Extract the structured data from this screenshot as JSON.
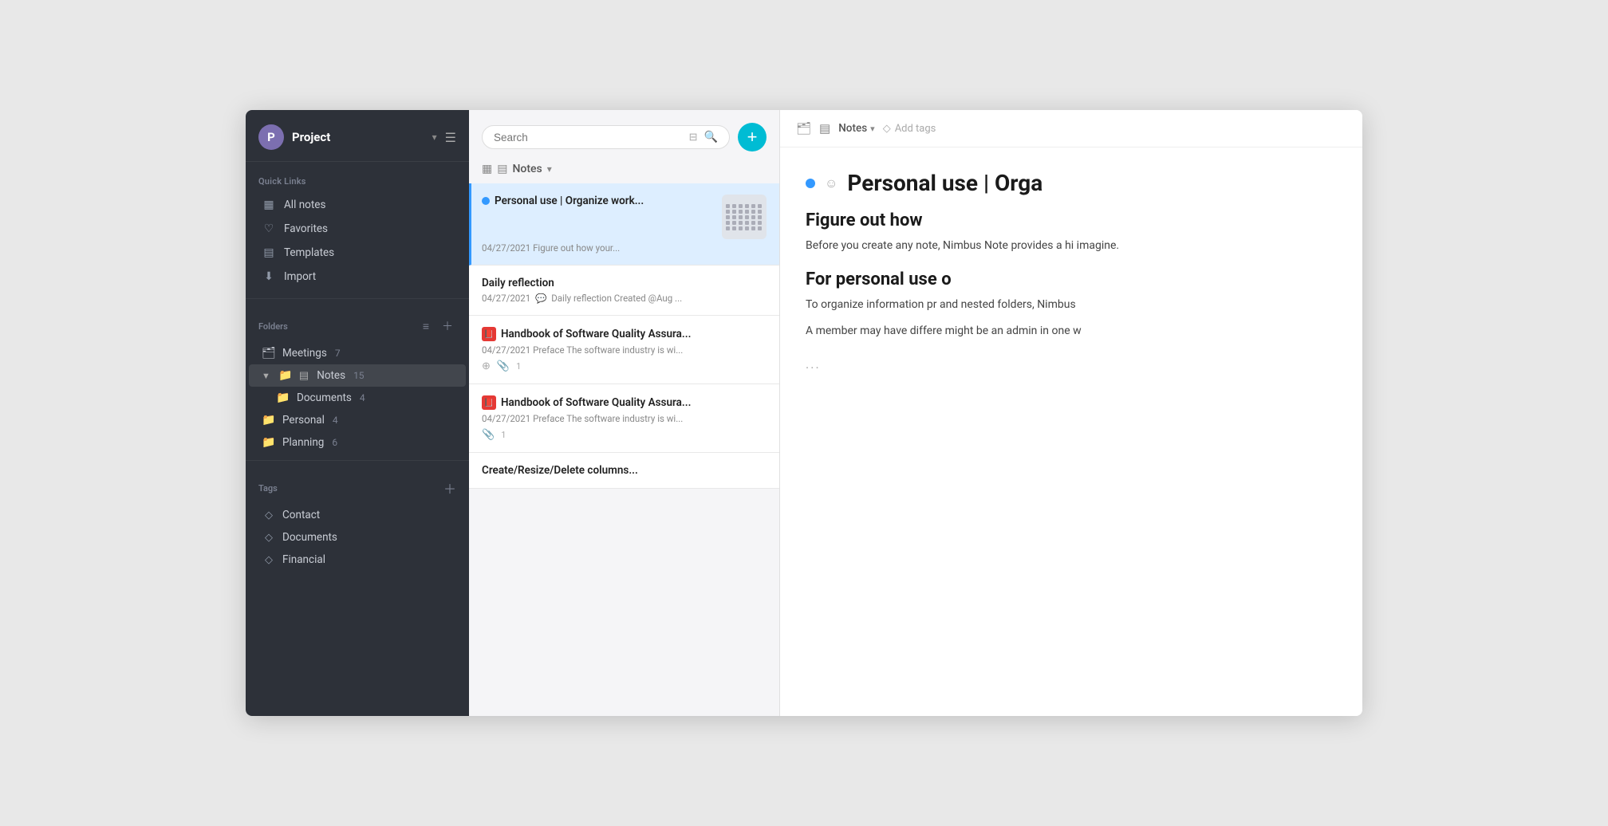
{
  "app": {
    "title": "Project"
  },
  "sidebar": {
    "project_initial": "P",
    "project_name": "Project",
    "quick_links_label": "Quick Links",
    "items": [
      {
        "id": "all-notes",
        "label": "All notes",
        "icon": "▦"
      },
      {
        "id": "favorites",
        "label": "Favorites",
        "icon": "♡"
      },
      {
        "id": "templates",
        "label": "Templates",
        "icon": "▤"
      },
      {
        "id": "import",
        "label": "Import",
        "icon": "⬇"
      }
    ],
    "folders_label": "Folders",
    "folders": [
      {
        "id": "meetings",
        "label": "Meetings",
        "count": "7",
        "level": 0,
        "icon": "📁"
      },
      {
        "id": "notes",
        "label": "Notes",
        "count": "15",
        "level": 0,
        "active": true,
        "icon": "📁",
        "has_note_icon": true
      },
      {
        "id": "documents",
        "label": "Documents",
        "count": "4",
        "level": 1,
        "icon": "📁"
      },
      {
        "id": "personal",
        "label": "Personal",
        "count": "4",
        "level": 0,
        "icon": "📁"
      },
      {
        "id": "planning",
        "label": "Planning",
        "count": "6",
        "level": 0,
        "icon": "📁"
      }
    ],
    "tags_label": "Tags",
    "tags": [
      {
        "id": "contact",
        "label": "Contact"
      },
      {
        "id": "documents",
        "label": "Documents"
      },
      {
        "id": "financial",
        "label": "Financial"
      }
    ]
  },
  "note_list": {
    "search_placeholder": "Search",
    "notes_label": "Notes",
    "add_button_label": "+",
    "notes": [
      {
        "id": "personal-use",
        "title": "Personal use | Organize work...",
        "date": "04/27/2021",
        "preview": "Figure out how your...",
        "selected": true,
        "has_dot": true,
        "has_thumb": true
      },
      {
        "id": "daily-reflection",
        "title": "Daily reflection",
        "date": "04/27/2021",
        "preview": "Daily reflection Created @Aug ...",
        "selected": false,
        "has_dot": false,
        "has_thumb": false,
        "preview_icon": "💬"
      },
      {
        "id": "handbook-1",
        "title": "Handbook of Software Quality Assura...",
        "date": "04/27/2021",
        "preview": "Preface The software industry is wi...",
        "selected": false,
        "has_red_icon": true,
        "attach_count": "1"
      },
      {
        "id": "handbook-2",
        "title": "Handbook of Software Quality Assura...",
        "date": "04/27/2021",
        "preview": "Preface The software industry is wi...",
        "selected": false,
        "has_red_icon": true,
        "attach_count": "1"
      },
      {
        "id": "create-resize",
        "title": "Create/Resize/Delete columns...",
        "date": "",
        "preview": "",
        "selected": false
      }
    ]
  },
  "content": {
    "folder_icon_label": "folder-icon",
    "note_icon_label": "note-icon",
    "folder_label": "Notes",
    "add_tags_label": "Add tags",
    "title": "Personal use | Orga",
    "title_full": "Personal use | Organize work...",
    "heading": "Figure out how",
    "heading_full": "Figure out how your...",
    "paragraph1": "Before you create any note",
    "paragraph1_full": "Before you create any note, Nimbus Note provides a hi imagine.",
    "subtitle": "For personal use o",
    "subtitle_full": "For personal use of...",
    "paragraph2": "To organize information pr",
    "paragraph2_full": "To organize information pr and nested folders, Nimbus",
    "paragraph3": "A member may have differe",
    "paragraph3_full": "A member may have differe might be an admin in one w",
    "ellipsis": "..."
  }
}
